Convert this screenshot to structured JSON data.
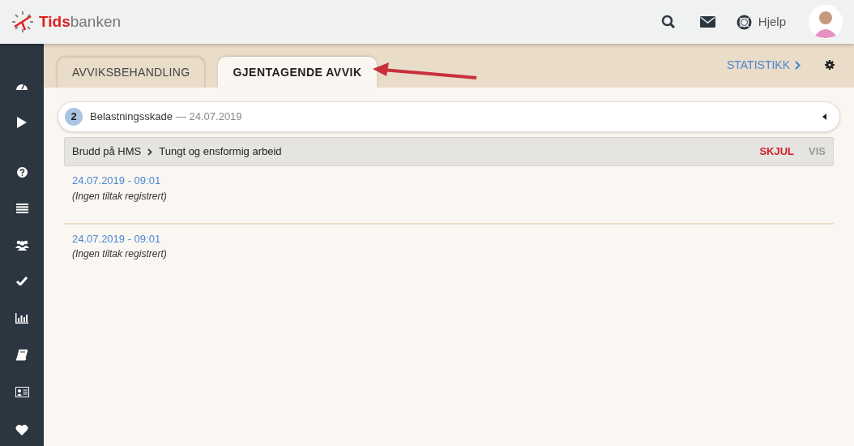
{
  "header": {
    "logo": {
      "part_1": "Tids",
      "part_2": "banken"
    },
    "help_label": "Hjelp"
  },
  "tabs": [
    {
      "label": "AVVIKSBEHANDLING",
      "selected": false
    },
    {
      "label": "GJENTAGENDE AVVIK",
      "selected": true
    }
  ],
  "statistics_link": "STATISTIKK",
  "group": {
    "count": "2",
    "title": "Belastningsskade",
    "date": "— 24.07.2019",
    "expanded": true,
    "category": {
      "parent": "Brudd på HMS",
      "child": "Tungt og ensformig arbeid",
      "toggles": [
        {
          "label": "SKJUL",
          "selected": true
        },
        {
          "label": "VIS",
          "selected": false
        }
      ]
    },
    "entries": [
      {
        "timestamp": "24.07.2019 - 09:01",
        "note": "(Ingen tiltak registrert)"
      },
      {
        "timestamp": "24.07.2019 - 09:01",
        "note": "(Ingen tiltak registrert)"
      }
    ]
  }
}
